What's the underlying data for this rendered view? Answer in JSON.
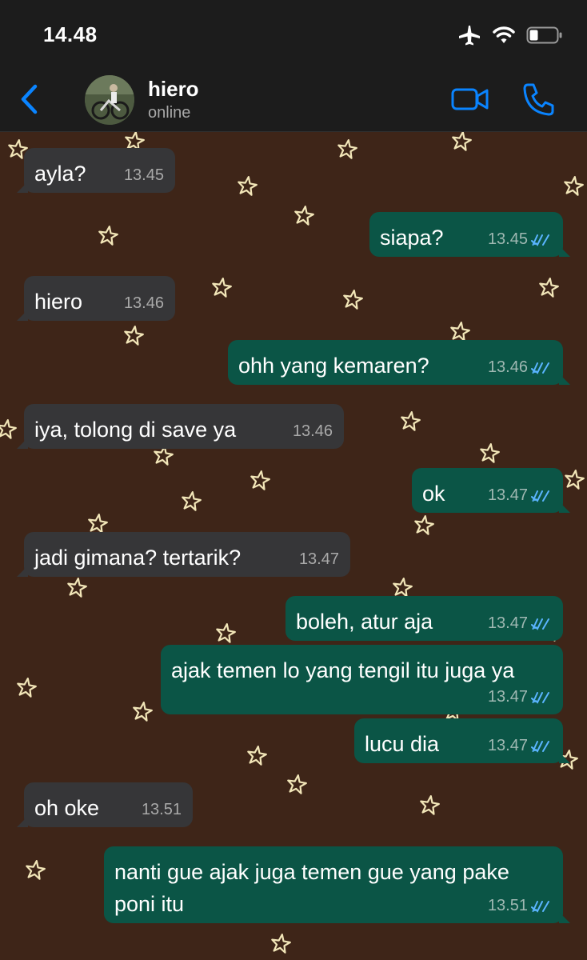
{
  "status_bar": {
    "time": "14.48"
  },
  "header": {
    "contact_name": "hiero",
    "contact_status": "online"
  },
  "colors": {
    "accent": "#0a84ff",
    "incoming_bubble": "#363638",
    "outgoing_bubble": "#0b5546",
    "wallpaper": "#3e2518",
    "read_ticks": "#5ab4ff"
  },
  "messages": [
    {
      "text": "ayla?",
      "time": "13.45",
      "dir": "in"
    },
    {
      "text": "siapa?",
      "time": "13.45",
      "dir": "out"
    },
    {
      "text": "hiero",
      "time": "13.46",
      "dir": "in"
    },
    {
      "text": "ohh yang kemaren?",
      "time": "13.46",
      "dir": "out"
    },
    {
      "text": "iya, tolong di save ya",
      "time": "13.46",
      "dir": "in"
    },
    {
      "text": "ok",
      "time": "13.47",
      "dir": "out"
    },
    {
      "text": "jadi gimana? tertarik?",
      "time": "13.47",
      "dir": "in"
    },
    {
      "text": "boleh, atur aja",
      "time": "13.47",
      "dir": "out"
    },
    {
      "text": "ajak temen lo yang tengil itu juga ya",
      "time": "13.47",
      "dir": "out"
    },
    {
      "text": "lucu dia",
      "time": "13.47",
      "dir": "out"
    },
    {
      "text": "oh oke",
      "time": "13.51",
      "dir": "in"
    },
    {
      "text": "nanti gue ajak juga temen gue yang pake\nponi itu",
      "time": "13.51",
      "dir": "out"
    }
  ]
}
